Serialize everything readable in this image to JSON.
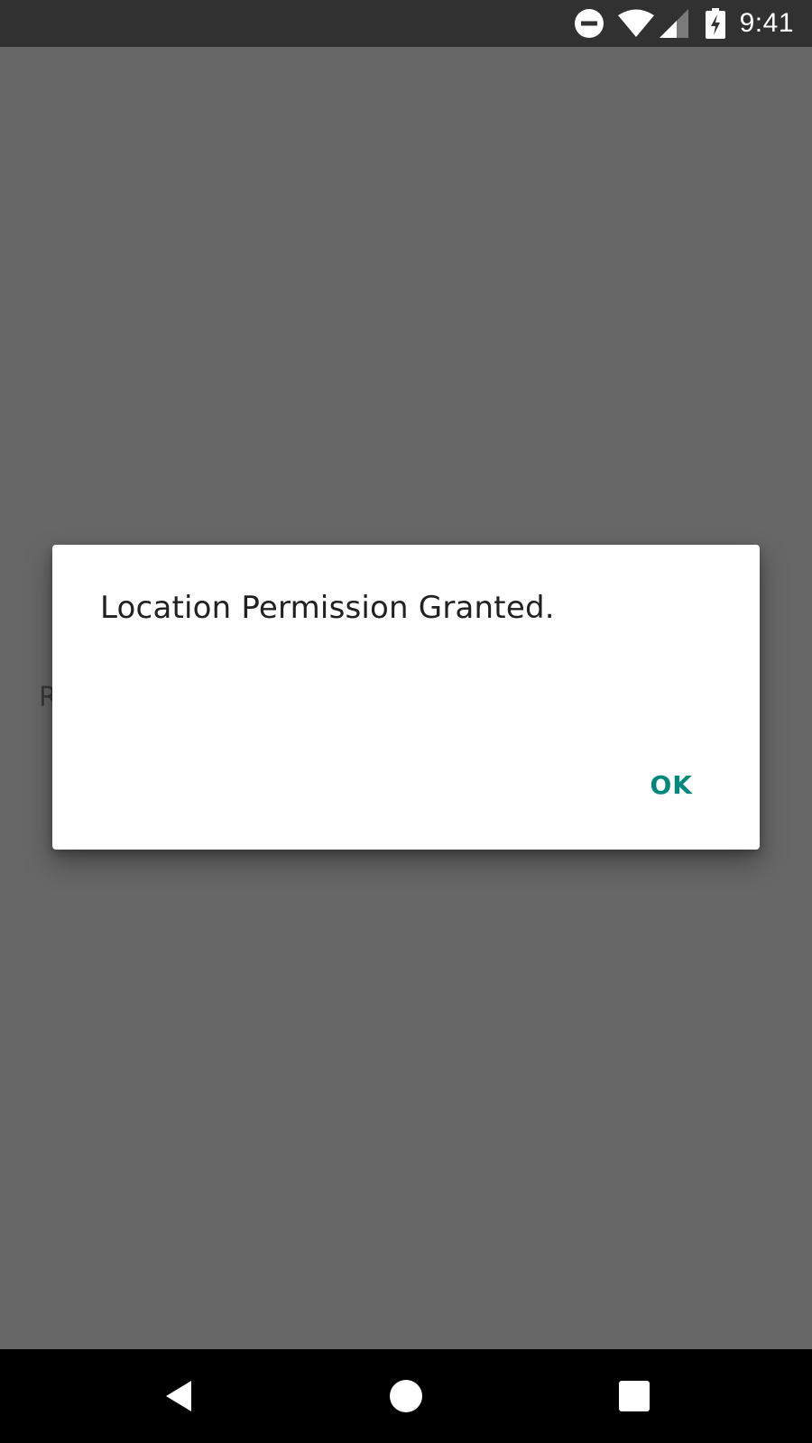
{
  "status_bar": {
    "time": "9:41",
    "icons": [
      "do-not-disturb-icon",
      "wifi-icon",
      "signal-icon",
      "battery-charging-icon"
    ]
  },
  "background": {
    "partial_text": "R"
  },
  "dialog": {
    "title": "Location Permission Granted.",
    "ok_label": "OK",
    "accent_color": "#00897b"
  },
  "nav_bar": {
    "buttons": [
      "back-icon",
      "home-icon",
      "recents-icon"
    ]
  },
  "colors": {
    "scrim": "#676767",
    "status_bar": "#313131",
    "nav_bar": "#000000"
  }
}
